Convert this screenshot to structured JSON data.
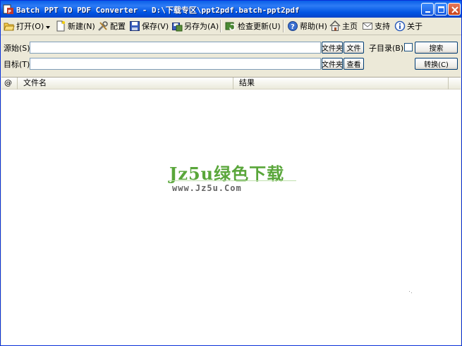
{
  "window": {
    "title": "Batch PPT TO PDF Converter - D:\\下载专区\\ppt2pdf.batch-ppt2pdf"
  },
  "toolbar": {
    "open": "打开(O)",
    "new": "新建(N)",
    "config": "配置",
    "save": "保存(V)",
    "save_as": "另存为(A)",
    "check_update": "检查更新(U)",
    "help": "帮助(H)",
    "home": "主页",
    "support": "支持",
    "about": "关于"
  },
  "source": {
    "label": "源始(S)",
    "value": "",
    "folder_btn": "文件夹",
    "file_btn": "文件",
    "subdir_label": "子目录(B)",
    "search_btn": "搜索"
  },
  "target": {
    "label": "目标(T)",
    "value": "",
    "folder_btn": "文件夹",
    "view_btn": "查看",
    "convert_btn": "转换(C)"
  },
  "list": {
    "columns": [
      "@",
      "文件名",
      "结果"
    ]
  },
  "watermark": {
    "main": "Jz5u绿色下载",
    "sub": "www.Jz5u.Com"
  },
  "colors": {
    "title_bar": "#0054e3",
    "watermark_green": "#59a63a",
    "window_face": "#ece9d8"
  }
}
